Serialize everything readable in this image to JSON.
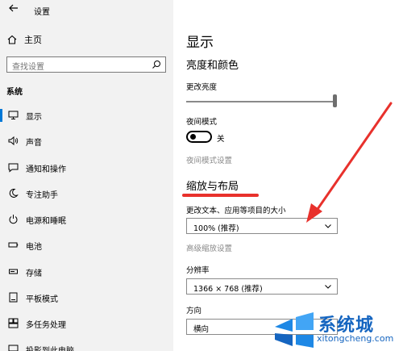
{
  "titlebar": {
    "title": "设置",
    "back_icon": "arrow-left-icon"
  },
  "sidebar": {
    "home_label": "主页",
    "search_placeholder": "查找设置",
    "section_label": "系统",
    "items": [
      {
        "label": "显示",
        "icon": "monitor-icon",
        "selected": true
      },
      {
        "label": "声音",
        "icon": "speaker-icon",
        "selected": false
      },
      {
        "label": "通知和操作",
        "icon": "notification-icon",
        "selected": false
      },
      {
        "label": "专注助手",
        "icon": "moon-icon",
        "selected": false
      },
      {
        "label": "电源和睡眠",
        "icon": "power-icon",
        "selected": false
      },
      {
        "label": "电池",
        "icon": "battery-icon",
        "selected": false
      },
      {
        "label": "存储",
        "icon": "storage-icon",
        "selected": false
      },
      {
        "label": "平板模式",
        "icon": "tablet-icon",
        "selected": false
      },
      {
        "label": "多任务处理",
        "icon": "multitask-icon",
        "selected": false
      },
      {
        "label": "投影到此电脑",
        "icon": "project-icon",
        "selected": false
      }
    ]
  },
  "main": {
    "title": "显示",
    "brightness_section": "亮度和颜色",
    "brightness_label": "更改亮度",
    "brightness_value": 1.0,
    "night_light_label": "夜间模式",
    "night_light_state": "关",
    "night_light_settings": "夜间模式设置",
    "scale_section": "缩放与布局",
    "scale_label": "更改文本、应用等项目的大小",
    "scale_value": "100% (推荐)",
    "advanced_scaling": "高级缩放设置",
    "resolution_label": "分辨率",
    "resolution_value": "1366 × 768 (推荐)",
    "orientation_label": "方向",
    "orientation_value": "横向"
  },
  "annotations": {
    "color": "#e8312c"
  },
  "watermark": {
    "brand": "系统城",
    "url": "xitongcheng.com",
    "color": "#1565c0"
  }
}
